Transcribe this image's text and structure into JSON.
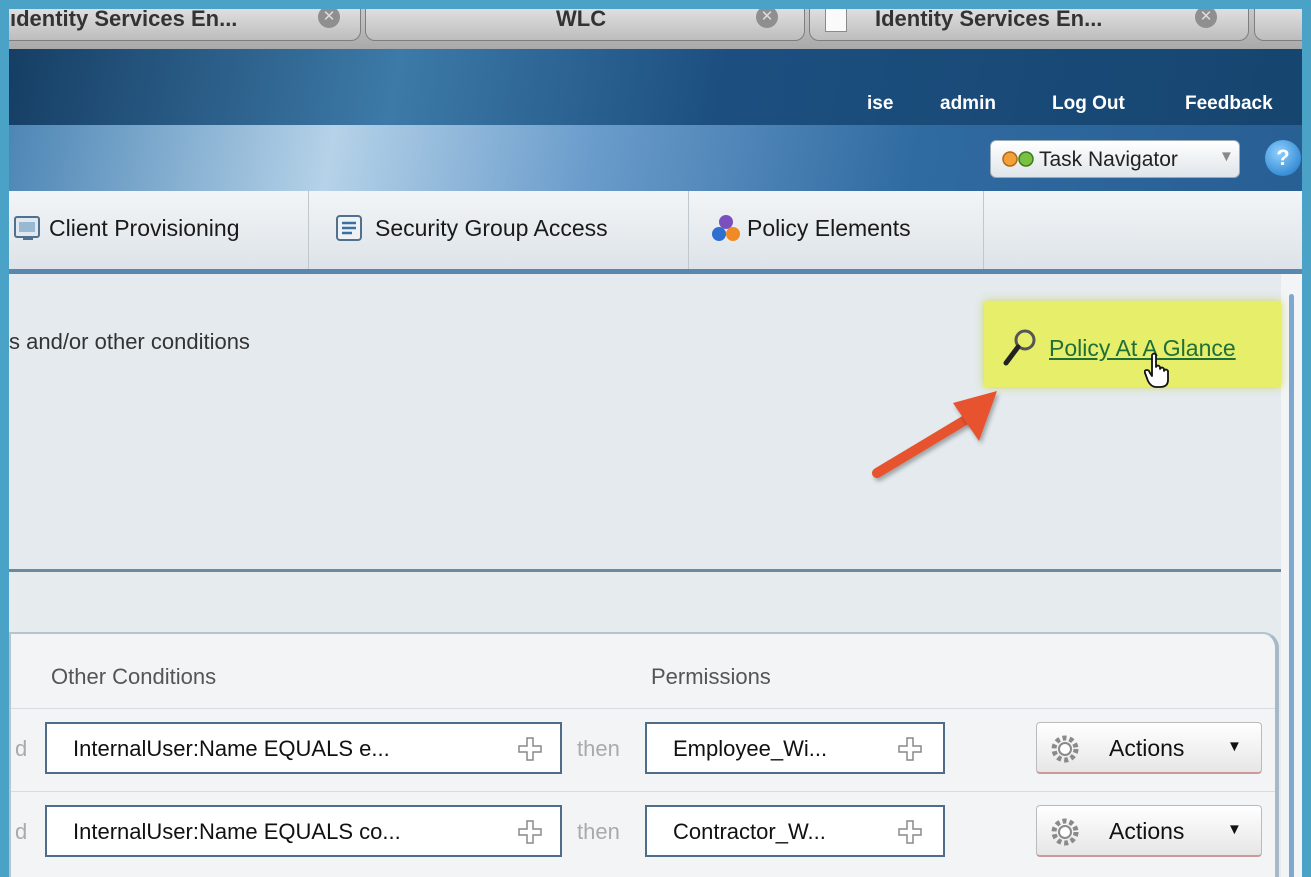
{
  "browser": {
    "tabs": [
      {
        "title": "ıdentity Services En..."
      },
      {
        "title": "WLC"
      },
      {
        "title": "Identity Services En..."
      }
    ]
  },
  "header": {
    "links": {
      "host": "ise",
      "user": "admin",
      "logout": "Log Out",
      "feedback": "Feedback"
    },
    "task_navigator": "Task Navigator"
  },
  "nav": {
    "tabs": [
      {
        "label": "Client Provisioning",
        "icon": "client-provisioning-icon"
      },
      {
        "label": "Security Group Access",
        "icon": "security-group-access-icon"
      },
      {
        "label": "Policy Elements",
        "icon": "policy-elements-icon"
      }
    ]
  },
  "main": {
    "description": "s and/or other conditions",
    "glance_link": "Policy At A Glance"
  },
  "table": {
    "columns": {
      "conditions": "Other Conditions",
      "permissions": "Permissions"
    },
    "rows": [
      {
        "prefix": "d",
        "condition": "InternalUser:Name EQUALS e...",
        "then": "then",
        "permission": "Employee_Wi...",
        "action": "Actions"
      },
      {
        "prefix": "d",
        "condition": "InternalUser:Name EQUALS co...",
        "then": "then",
        "permission": "Contractor_W...",
        "action": "Actions"
      }
    ]
  },
  "colors": {
    "highlight": "#e6ee6a",
    "link": "#1f6f3a",
    "arrow": "#e8532f",
    "header": "#1c4f80"
  }
}
